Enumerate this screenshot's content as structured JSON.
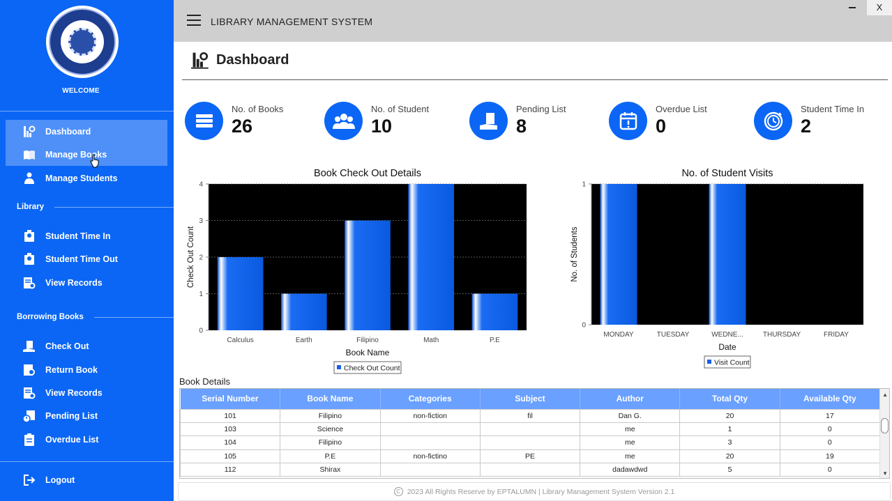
{
  "sidebar": {
    "welcome": "WELCOME",
    "nav": [
      {
        "label": "Dashboard",
        "icon": "dashboard-icon"
      },
      {
        "label": "Manage Books",
        "icon": "book-icon"
      },
      {
        "label": "Manage Students",
        "icon": "student-icon"
      }
    ],
    "library_label": "Library",
    "library": [
      {
        "label": "Student Time In",
        "icon": "time-in-icon"
      },
      {
        "label": "Student Time Out",
        "icon": "time-out-icon"
      },
      {
        "label": "View Records",
        "icon": "records-icon"
      }
    ],
    "borrowing_label": "Borrowing Books",
    "borrowing": [
      {
        "label": "Check Out",
        "icon": "checkout-icon"
      },
      {
        "label": "Return Book",
        "icon": "return-icon"
      },
      {
        "label": "View Records",
        "icon": "records-icon"
      },
      {
        "label": "Pending List",
        "icon": "pending-icon"
      },
      {
        "label": "Overdue List",
        "icon": "overdue-icon"
      }
    ],
    "logout": "Logout"
  },
  "header": {
    "title": "LIBRARY MANAGEMENT SYSTEM",
    "minimize": "▬",
    "close": "X"
  },
  "page": {
    "title": "Dashboard"
  },
  "stats": [
    {
      "label": "No. of Books",
      "value": "26",
      "icon": "books-icon"
    },
    {
      "label": "No. of Student",
      "value": "10",
      "icon": "students-icon"
    },
    {
      "label": "Pending List",
      "value": "8",
      "icon": "pending-book-icon"
    },
    {
      "label": "Overdue List",
      "value": "0",
      "icon": "calendar-alert-icon"
    },
    {
      "label": "Student Time In",
      "value": "2",
      "icon": "clock-icon"
    }
  ],
  "chart_data": [
    {
      "type": "bar",
      "title": "Book  Check Out Details",
      "xlabel": "Book Name",
      "ylabel": "Check Out Count",
      "categories": [
        "Calculus",
        "Earth",
        "Filipino",
        "Math",
        "P.E"
      ],
      "series": [
        {
          "name": "Check Out Count",
          "values": [
            2,
            1,
            3,
            4,
            1
          ]
        }
      ],
      "ylim": [
        0,
        4
      ],
      "yticks": [
        0,
        1,
        2,
        3,
        4
      ],
      "grid": true,
      "legend": "bottom-center",
      "colors": {
        "plot_bg": "#000000",
        "bar": "#1a6cf2"
      }
    },
    {
      "type": "bar",
      "title": "No. of Student Visits",
      "xlabel": "Date",
      "ylabel": "No. of Students",
      "categories": [
        "MONDAY",
        "TUESDAY",
        "WEDNE...",
        "THURSDAY",
        "FRIDAY"
      ],
      "series": [
        {
          "name": "Visit Count",
          "values": [
            1,
            0,
            1,
            0,
            0
          ]
        }
      ],
      "ylim": [
        0,
        1
      ],
      "yticks": [
        0,
        1
      ],
      "grid": true,
      "legend": "bottom-center",
      "colors": {
        "plot_bg": "#000000",
        "bar": "#1a6cf2"
      }
    }
  ],
  "table": {
    "caption": "Book Details",
    "columns": [
      "Serial Number",
      "Book Name",
      "Categories",
      "Subject",
      "Author",
      "Total Qty",
      "Available Qty"
    ],
    "rows": [
      [
        "101",
        "Filipino",
        "non-fiction",
        "fil",
        "Dan G.",
        "20",
        "17"
      ],
      [
        "103",
        "Science",
        "",
        "",
        "me",
        "1",
        "0"
      ],
      [
        "104",
        "Filipino",
        "",
        "",
        "me",
        "3",
        "0"
      ],
      [
        "105",
        "P.E",
        "non-fictino",
        "PE",
        "me",
        "20",
        "19"
      ],
      [
        "112",
        "Shirax",
        "",
        "",
        "dadawdwd",
        "5",
        "0"
      ]
    ]
  },
  "footer": {
    "copyright_symbol": "C",
    "text": "2023 All Rights Reserve by EPTALUMN |  Library Management System Version 2.1"
  },
  "colors": {
    "sidebar": "#0b66f5",
    "header": "#cfcfcf",
    "accent": "#0b66f5",
    "table_header": "#6aa0ff"
  }
}
